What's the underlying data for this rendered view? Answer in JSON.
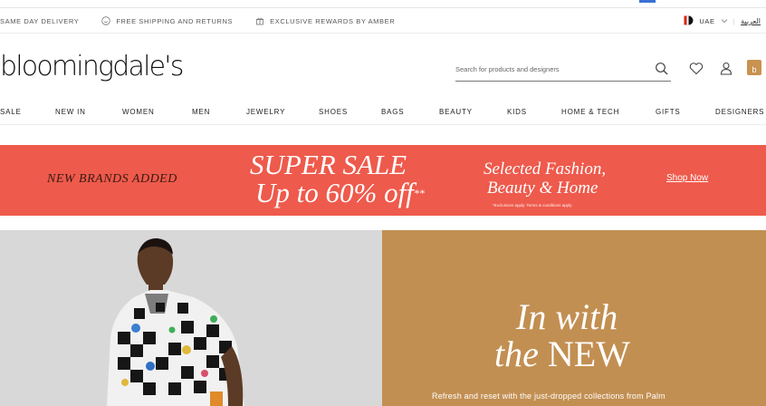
{
  "utility_bar": {
    "items": [
      {
        "label": "SAME DAY DELIVERY",
        "icon": "none"
      },
      {
        "label": "FREE SHIPPING AND RETURNS",
        "icon": "smile-icon"
      },
      {
        "label": "EXCLUSIVE REWARDS BY AMBER",
        "icon": "gift-icon"
      }
    ],
    "country": "UAE",
    "language_link": "العربية"
  },
  "header": {
    "logo": "bloomingdale's",
    "search_placeholder": "Search for products and designers",
    "bag_badge": "b"
  },
  "nav": {
    "items": [
      "SALE",
      "NEW IN",
      "WOMEN",
      "MEN",
      "JEWELRY",
      "SHOES",
      "BAGS",
      "BEAUTY",
      "KIDS",
      "HOME & TECH",
      "GIFTS",
      "DESIGNERS"
    ]
  },
  "promo": {
    "left_text": "NEW BRANDS ADDED",
    "headline_line1": "SUPER SALE",
    "headline_line2": "Up to 60% off",
    "headline_mark": "**",
    "mid_line1": "Selected Fashion,",
    "mid_line2": "Beauty & Home",
    "fine_print": "*Exclusions apply. Terms & conditions apply.",
    "cta": "Shop Now",
    "bg_color": "#ee5a4c"
  },
  "hero": {
    "title_line1": "In with",
    "title_line2_a": "the ",
    "title_line2_b": "NEW",
    "subtitle": "Refresh and reset with the just-dropped collections from Palm",
    "bg_color": "#c28f52"
  }
}
